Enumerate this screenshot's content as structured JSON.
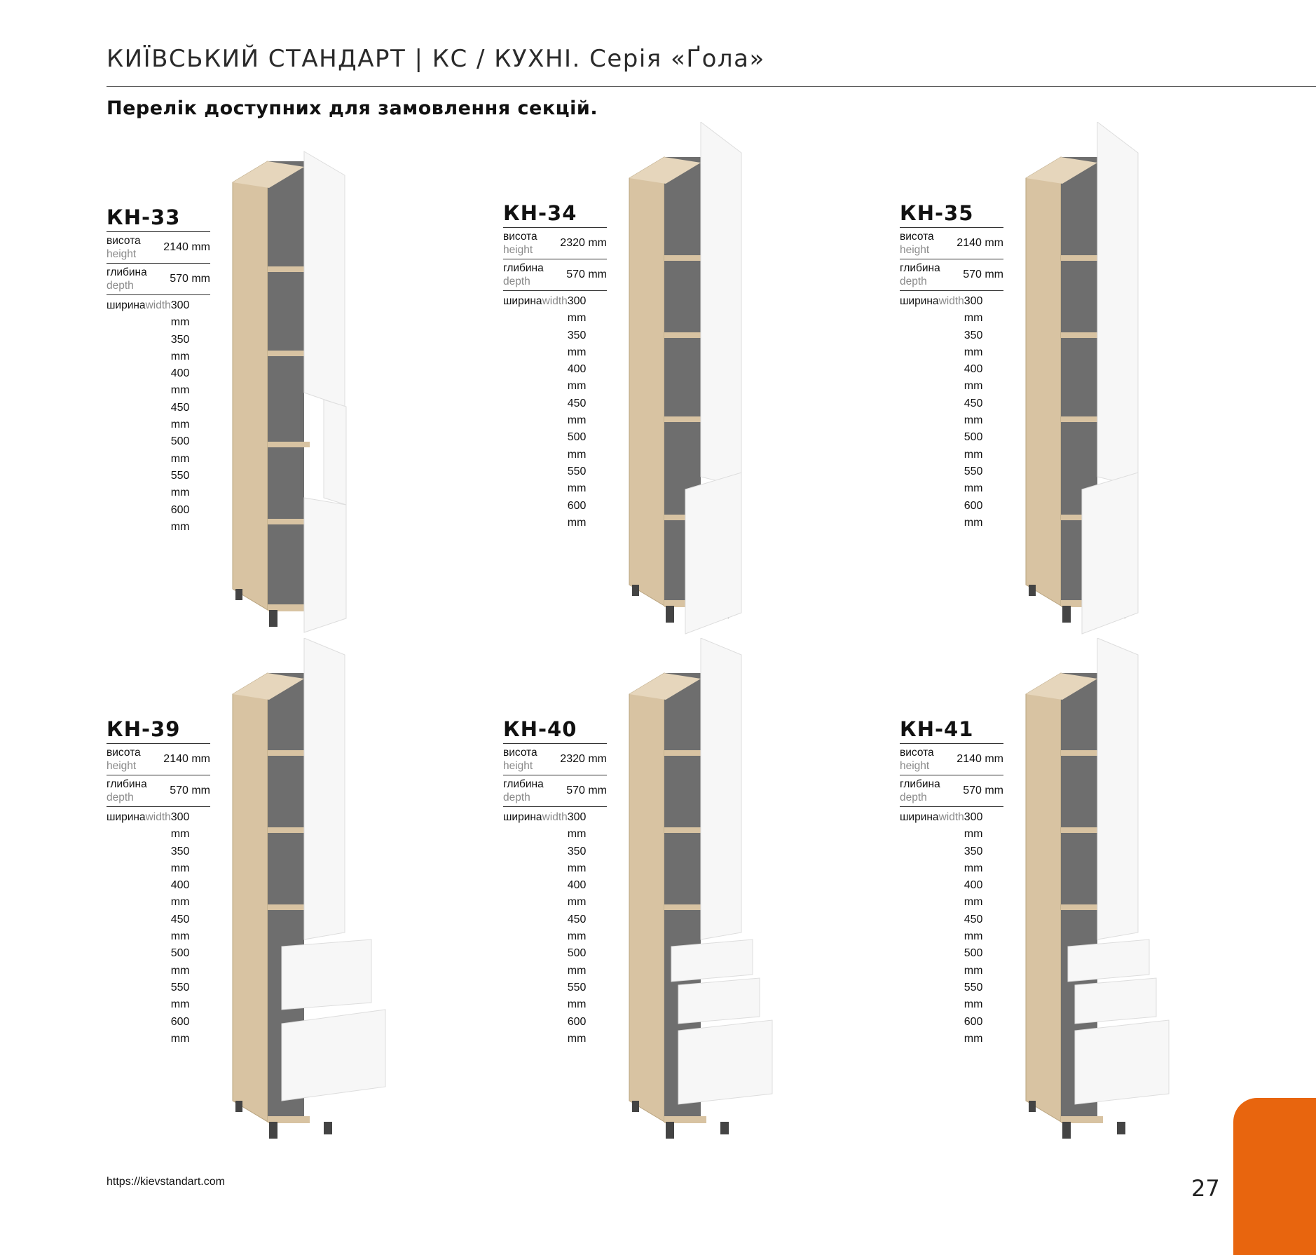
{
  "header": {
    "title": "КИЇВСЬКИЙ СТАНДАРТ   |   КС / КУХНІ.  Серія «Ґола»",
    "subtitle": "Перелік доступних для замовлення секцій."
  },
  "labels": {
    "height_ua": "висота",
    "height_en": "height",
    "depth_ua": "глибина",
    "depth_en": "depth",
    "width_ua": "ширина",
    "width_en": "width"
  },
  "products": [
    {
      "model": "КН-33",
      "height": "2140 mm",
      "depth": "570 mm",
      "widths": [
        "300 mm",
        "350 mm",
        "400 mm",
        "450 mm",
        "500 mm",
        "550 mm",
        "600 mm"
      ]
    },
    {
      "model": "КН-34",
      "height": "2320 mm",
      "depth": "570 mm",
      "widths": [
        "300 mm",
        "350 mm",
        "400 mm",
        "450 mm",
        "500 mm",
        "550 mm",
        "600 mm"
      ]
    },
    {
      "model": "КН-35",
      "height": "2140 mm",
      "depth": "570 mm",
      "widths": [
        "300 mm",
        "350 mm",
        "400 mm",
        "450 mm",
        "500 mm",
        "550 mm",
        "600 mm"
      ]
    },
    {
      "model": "КН-39",
      "height": "2140 mm",
      "depth": "570 mm",
      "widths": [
        "300 mm",
        "350 mm",
        "400 mm",
        "450 mm",
        "500 mm",
        "550 mm",
        "600 mm"
      ]
    },
    {
      "model": "КН-40",
      "height": "2320 mm",
      "depth": "570 mm",
      "widths": [
        "300 mm",
        "350 mm",
        "400 mm",
        "450 mm",
        "500 mm",
        "550 mm",
        "600 mm"
      ]
    },
    {
      "model": "КН-41",
      "height": "2140 mm",
      "depth": "570 mm",
      "widths": [
        "300 mm",
        "350 mm",
        "400 mm",
        "450 mm",
        "500 mm",
        "550 mm",
        "600 mm"
      ]
    }
  ],
  "colors": {
    "accent": "#e8650e",
    "wood": "#d8c3a2",
    "interior": "#6e6e6e",
    "door": "#f7f7f7"
  },
  "footer": {
    "url": "https://kievstandart.com",
    "page_number": "27"
  }
}
